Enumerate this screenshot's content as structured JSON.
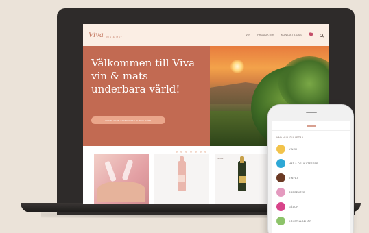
{
  "site": {
    "logo": "Viva",
    "logo_sub": "VIN & MAT",
    "nav": [
      "VIN",
      "PRODUKTER",
      "KONTAKTA OSS"
    ],
    "hero_title": "Välkommen till Viva vin & mats underbara värld!",
    "hero_button": "HANDLA VIN SOM DU SKA KUNNA KÖPA",
    "slider_dots": 8,
    "product_badge": "NYHET"
  },
  "phone": {
    "title": "VAD VILL DU LETA?",
    "categories": [
      {
        "label": "VINER",
        "color": "#f2c34b"
      },
      {
        "label": "MAT & DELIKATESSER",
        "color": "#2ea8d6"
      },
      {
        "label": "VINFAT",
        "color": "#6b3a24"
      },
      {
        "label": "PRESENTER",
        "color": "#e49abf"
      },
      {
        "label": "GÅVOR",
        "color": "#d8448a"
      },
      {
        "label": "KÖKSTILLBEHÖR",
        "color": "#8dc36a"
      }
    ]
  }
}
